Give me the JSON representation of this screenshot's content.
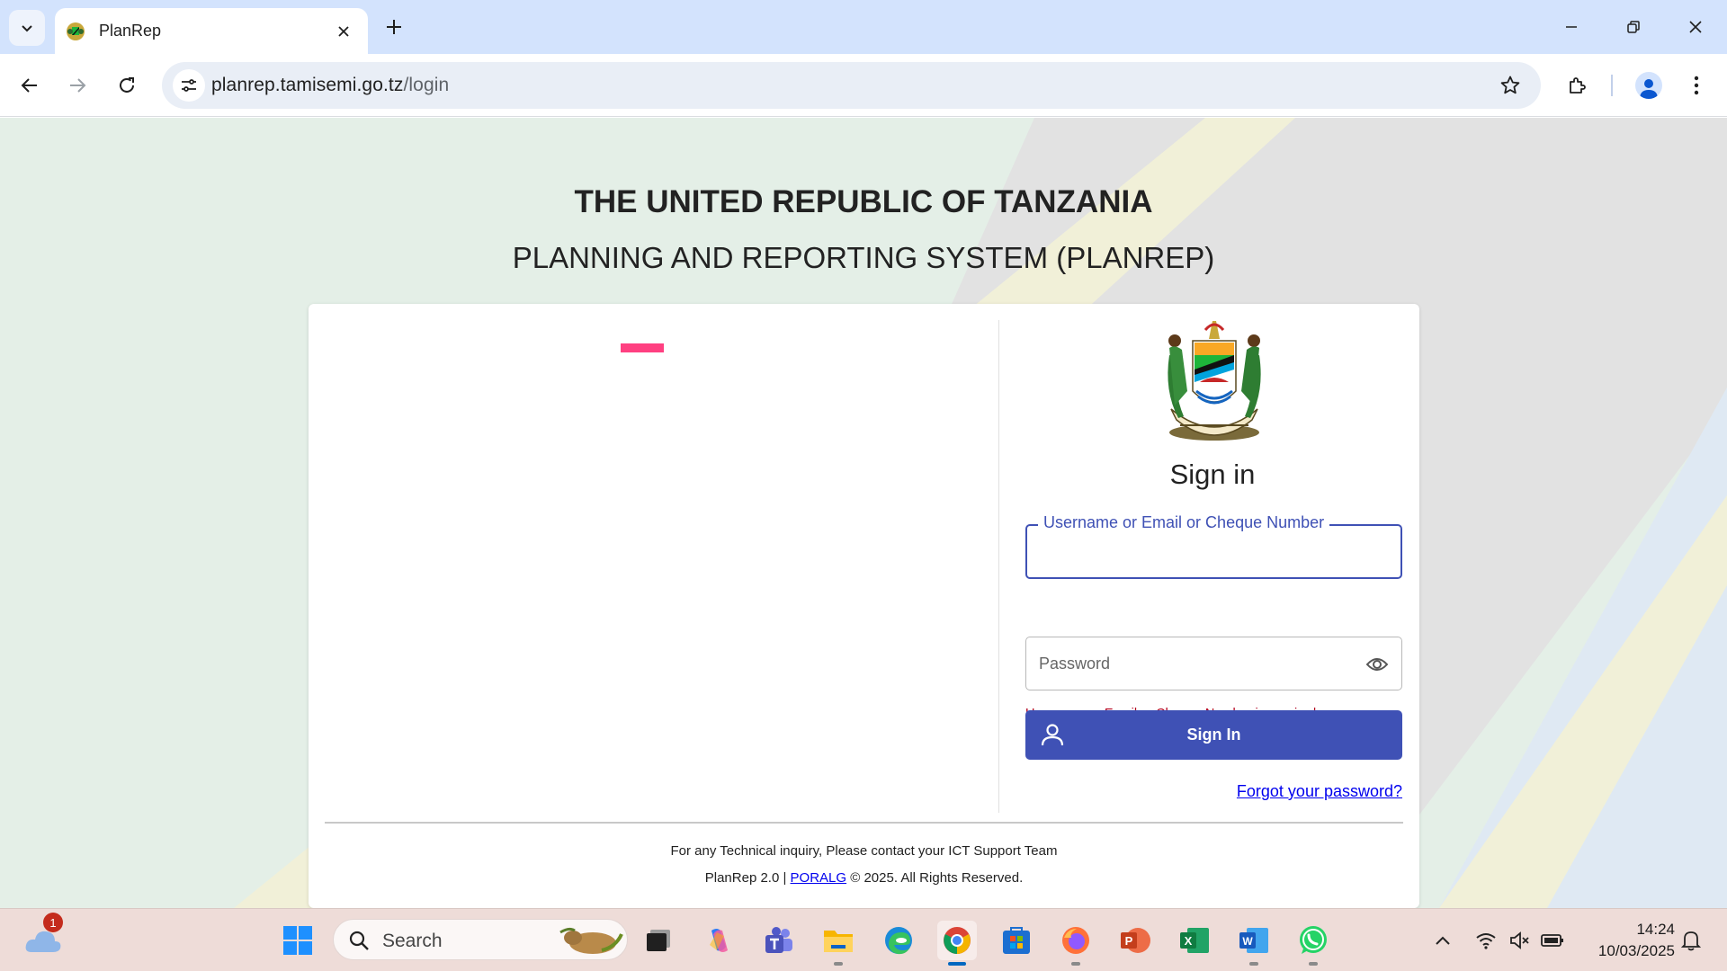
{
  "browser": {
    "tab_title": "PlanRep",
    "url_host": "planrep.tamisemi.go.tz",
    "url_path": "/login"
  },
  "page": {
    "heading_country": "THE UNITED REPUBLIC OF TANZANIA",
    "heading_system": "PLANNING AND REPORTING SYSTEM (PLANREP)",
    "signin_title": "Sign in",
    "username_label": "Username or Email or Cheque Number",
    "username_value": "",
    "username_error": "Username or Email or Cheque Number is required.",
    "password_placeholder": "Password",
    "signin_button": "Sign In",
    "forgot_password": "Forgot your password?",
    "footer_support": "For any Technical inquiry, Please contact your ICT Support Team",
    "footer_version": "PlanRep 2.0 |",
    "footer_link": "PORALG",
    "footer_copyright": "© 2025. All Rights Reserved."
  },
  "colors": {
    "primary": "#3f51b5",
    "error": "#b00020",
    "loader": "#ff4081",
    "link": "#0000ee"
  },
  "taskbar": {
    "weather_badge": "1",
    "search_label": "Search",
    "time": "14:24",
    "date": "10/03/2025",
    "apps": [
      "start-icon",
      "task-view-icon",
      "copilot-icon",
      "teams-icon",
      "file-explorer-icon",
      "edge-icon",
      "chrome-icon",
      "store-icon",
      "firefox-icon",
      "powerpoint-icon",
      "excel-icon",
      "word-icon",
      "whatsapp-icon"
    ]
  }
}
